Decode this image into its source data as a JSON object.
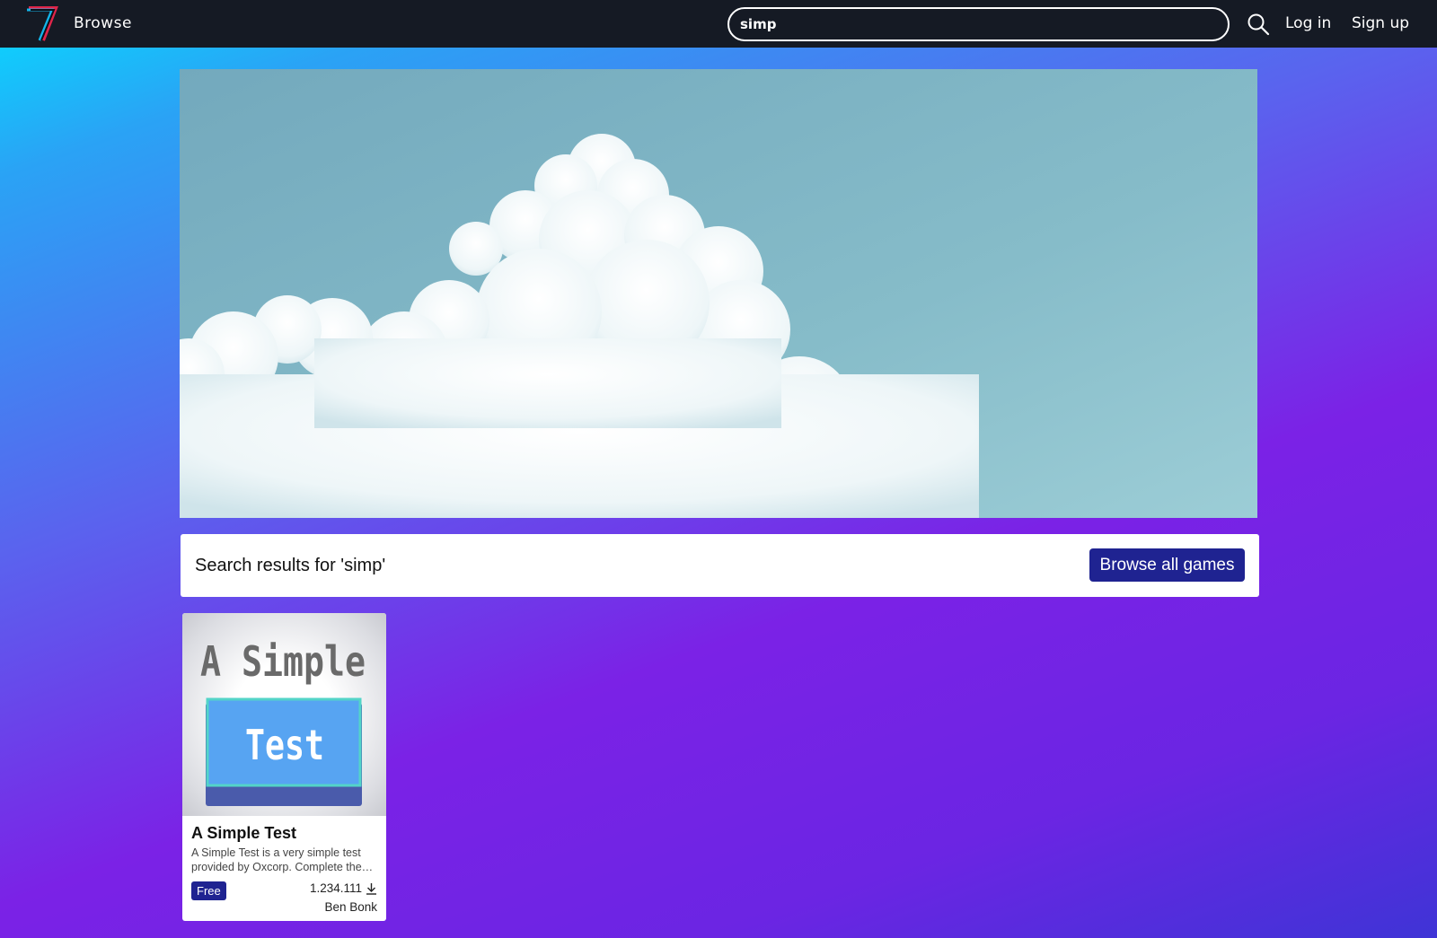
{
  "nav": {
    "browse_label": "Browse",
    "search_value": "simp",
    "login_label": "Log in",
    "signup_label": "Sign up"
  },
  "results": {
    "title": "Search results for 'simp'",
    "browse_all_label": "Browse all games"
  },
  "games": [
    {
      "title": "A Simple Test",
      "description": "A Simple Test is a very simple test provided by Oxcorp. Complete the…",
      "price": "Free",
      "downloads": "1.234.111",
      "author": "Ben Bonk",
      "thumb_text_top": "A Simple",
      "thumb_text_bottom": "Test"
    }
  ],
  "colors": {
    "navbar": "#151a24",
    "accent": "#1f2391",
    "gradient_start": "#06dcff",
    "gradient_end": "#7b22e6"
  },
  "icons": {
    "logo": "logo-seven-icon",
    "search": "search-icon",
    "download": "download-icon"
  }
}
